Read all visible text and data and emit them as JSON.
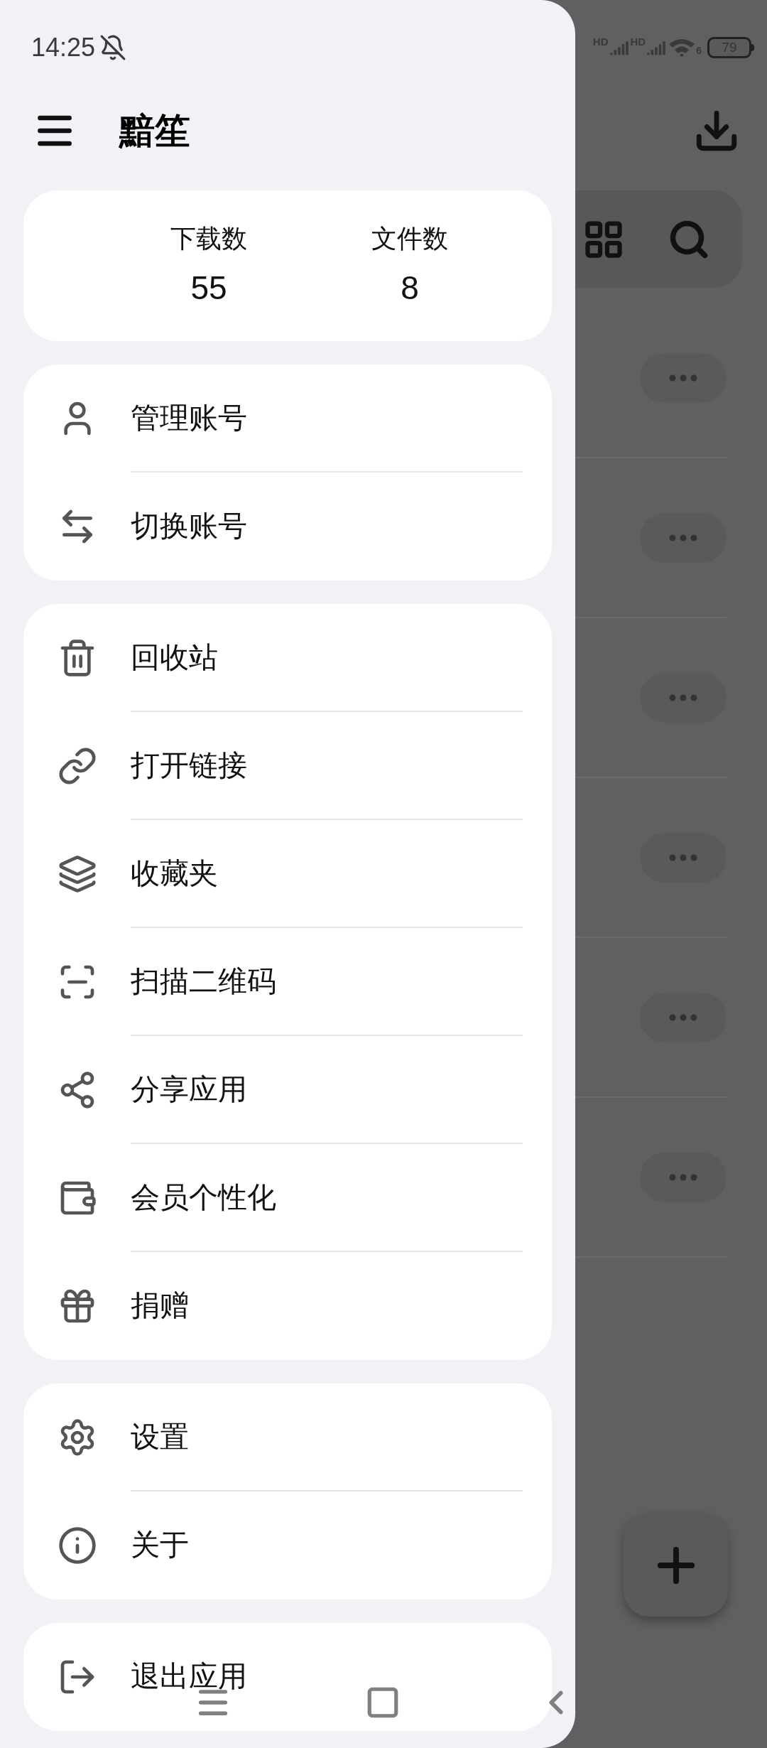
{
  "status_bar": {
    "time": "14:25",
    "sim_labels": [
      "HD",
      "HD"
    ],
    "wifi_label": "6",
    "battery": "79"
  },
  "drawer": {
    "title": "黯笙",
    "stats": [
      {
        "label": "下载数",
        "value": "55"
      },
      {
        "label": "文件数",
        "value": "8"
      }
    ],
    "menu_groups": [
      {
        "items": [
          {
            "label": "管理账号"
          },
          {
            "label": "切换账号"
          }
        ]
      },
      {
        "items": [
          {
            "label": "回收站"
          },
          {
            "label": "打开链接"
          },
          {
            "label": "收藏夹"
          },
          {
            "label": "扫描二维码"
          },
          {
            "label": "分享应用"
          },
          {
            "label": "会员个性化"
          },
          {
            "label": "捐赠"
          }
        ]
      },
      {
        "items": [
          {
            "label": "设置"
          },
          {
            "label": "关于"
          }
        ]
      },
      {
        "items": [
          {
            "label": "退出应用"
          }
        ]
      }
    ]
  }
}
